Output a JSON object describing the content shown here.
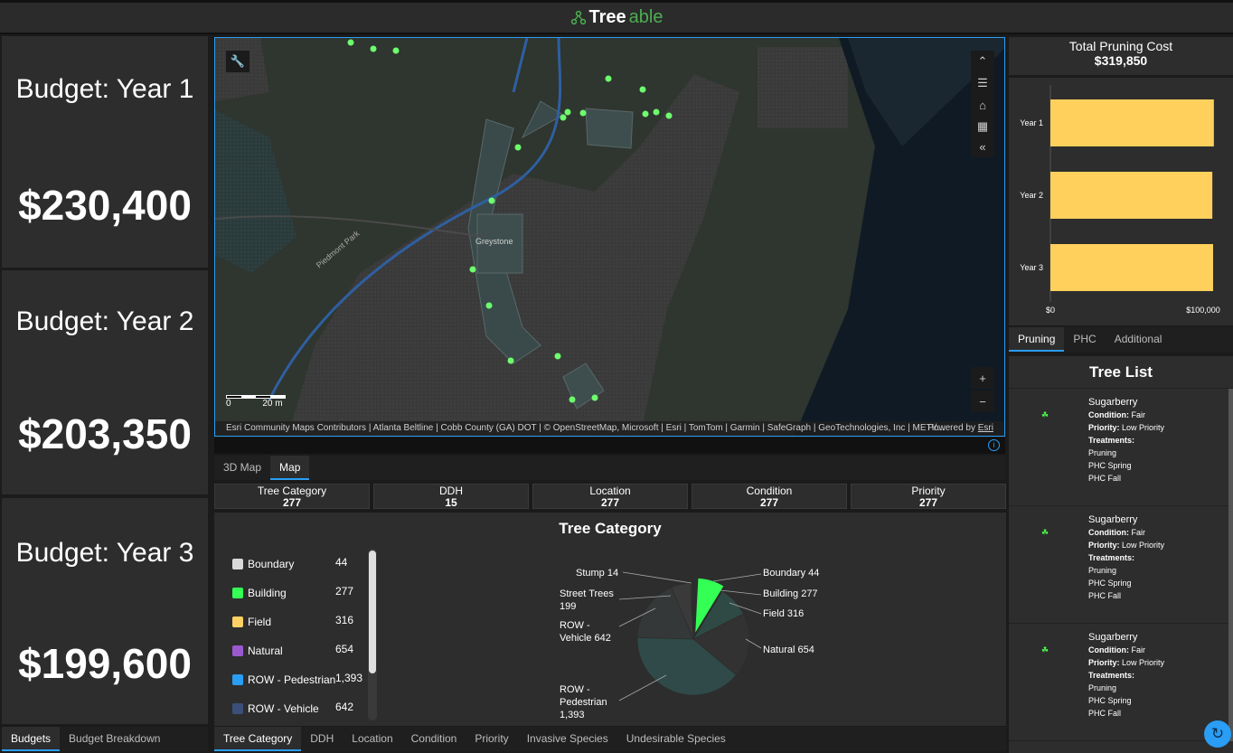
{
  "app": {
    "name_part1": "Tree",
    "name_part2": "able"
  },
  "budgets": [
    {
      "label": "Budget: Year 1",
      "value": "$230,400"
    },
    {
      "label": "Budget: Year 2",
      "value": "$203,350"
    },
    {
      "label": "Budget: Year 3",
      "value": "$199,600"
    }
  ],
  "left_tabs": [
    "Budgets",
    "Budget Breakdown"
  ],
  "map": {
    "building_label": "Greystone",
    "road_label": "Piedmont Park",
    "scale_0": "0",
    "scale_20": "20 m",
    "attribution": "Esri Community Maps Contributors | Atlanta Beltline | Cobb County (GA) DOT | © OpenStreetMap, Microsoft | Esri | TomTom | Garmin | SafeGraph | GeoTechnologies, Inc | METI/…",
    "powered_prefix": "Powered by",
    "powered_link": "Esri",
    "tabs": [
      "3D Map",
      "Map"
    ]
  },
  "stats": [
    {
      "label": "Tree Category",
      "value": "277"
    },
    {
      "label": "DDH",
      "value": "15"
    },
    {
      "label": "Location",
      "value": "277"
    },
    {
      "label": "Condition",
      "value": "277"
    },
    {
      "label": "Priority",
      "value": "277"
    }
  ],
  "category_panel": {
    "title": "Tree Category",
    "legend": [
      {
        "name": "Boundary",
        "value": "44",
        "color": "#d9d9d9"
      },
      {
        "name": "Building",
        "value": "277",
        "color": "#33ff55"
      },
      {
        "name": "Field",
        "value": "316",
        "color": "#ffd066"
      },
      {
        "name": "Natural",
        "value": "654",
        "color": "#9b59d0"
      },
      {
        "name": "ROW - Pedestrian",
        "value": "1,393",
        "color": "#2a9df4"
      },
      {
        "name": "ROW - Vehicle",
        "value": "642",
        "color": "#3b4f7a"
      }
    ],
    "pie_labels": {
      "stump": "Stump 14",
      "street_trees_1": "Street Trees",
      "street_trees_2": "199",
      "row_vehicle_1": "ROW -",
      "row_vehicle_2": "Vehicle 642",
      "row_ped_1": "ROW -",
      "row_ped_2": "Pedestrian",
      "row_ped_3": "1,393",
      "boundary": "Boundary 44",
      "building": "Building 277",
      "field": "Field 316",
      "natural": "Natural 654"
    },
    "tabs": [
      "Tree Category",
      "DDH",
      "Location",
      "Condition",
      "Priority",
      "Invasive Species",
      "Undesirable Species"
    ]
  },
  "chart_data": [
    {
      "type": "bar",
      "title": "Total Pruning Cost",
      "subtitle": "$319,850",
      "orientation": "horizontal",
      "categories": [
        "Year 1",
        "Year 2",
        "Year 3"
      ],
      "values": [
        107000,
        106000,
        106500
      ],
      "xlim": [
        0,
        100000
      ],
      "x_tick_labels": [
        "$0",
        "$100,000"
      ],
      "bar_color": "#ffd15c"
    },
    {
      "type": "pie",
      "categories": [
        "Boundary",
        "Building",
        "Field",
        "Natural",
        "ROW - Pedestrian",
        "ROW - Vehicle",
        "Street Trees",
        "Stump"
      ],
      "values": [
        44,
        277,
        316,
        654,
        1393,
        642,
        199,
        14
      ]
    }
  ],
  "pruning_tabs": [
    "Pruning",
    "PHC",
    "Additional"
  ],
  "tree_list": {
    "title": "Tree List",
    "items": [
      {
        "name": "Sugarberry",
        "condition_label": "Condition:",
        "condition": "Fair",
        "priority_label": "Priority:",
        "priority": "Low Priority",
        "treatments_label": "Treatments:",
        "treatments": [
          "Pruning",
          "PHC Spring",
          "PHC Fall"
        ]
      },
      {
        "name": "Sugarberry",
        "condition_label": "Condition:",
        "condition": "Fair",
        "priority_label": "Priority:",
        "priority": "Low Priority",
        "treatments_label": "Treatments:",
        "treatments": [
          "Pruning",
          "PHC Spring",
          "PHC Fall"
        ]
      },
      {
        "name": "Sugarberry",
        "condition_label": "Condition:",
        "condition": "Fair",
        "priority_label": "Priority:",
        "priority": "Low Priority",
        "treatments_label": "Treatments:",
        "treatments": [
          "Pruning",
          "PHC Spring",
          "PHC Fall"
        ]
      }
    ]
  },
  "icons": [
    "treeable-logo-icon",
    "wrench-icon",
    "chevron-up-icon",
    "list-icon",
    "home-icon",
    "qr-icon",
    "collapse-icon",
    "zoom-in-icon",
    "zoom-out-icon",
    "info-icon",
    "leaf-icon",
    "refresh-icon"
  ]
}
